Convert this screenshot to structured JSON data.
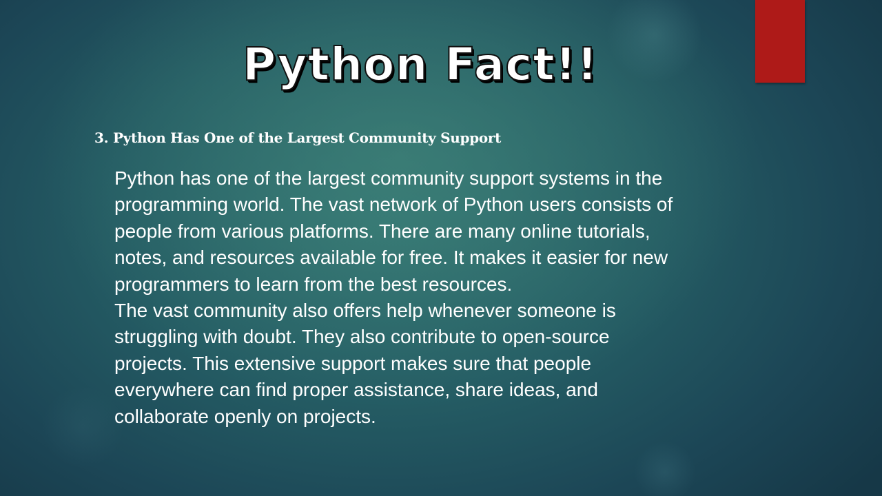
{
  "slide": {
    "title": "Python Fact!!",
    "subtitle": "3. Python Has One of the Largest Community Support",
    "paragraph_1_lines": [
      "Python has one of the largest community support systems in the",
      "programming world. The vast network of Python users consists of",
      "people from various platforms. There are many online tutorials,",
      "notes, and resources available for free. It makes it easier for new",
      "programmers to learn from the best resources."
    ],
    "paragraph_2_lines": [
      "The vast community also offers help whenever someone is",
      "struggling with doubt. They also contribute to open-source",
      "projects. This extensive support makes sure that people",
      "everywhere can find proper assistance, share ideas, and",
      "collaborate openly on projects."
    ]
  },
  "colors": {
    "accent_block": "#ae1a18",
    "title_fill": "#ffffff",
    "title_outline": "#000000",
    "text": "#ffffff",
    "background_dark": "#163847",
    "background_light": "#3a7f73"
  }
}
